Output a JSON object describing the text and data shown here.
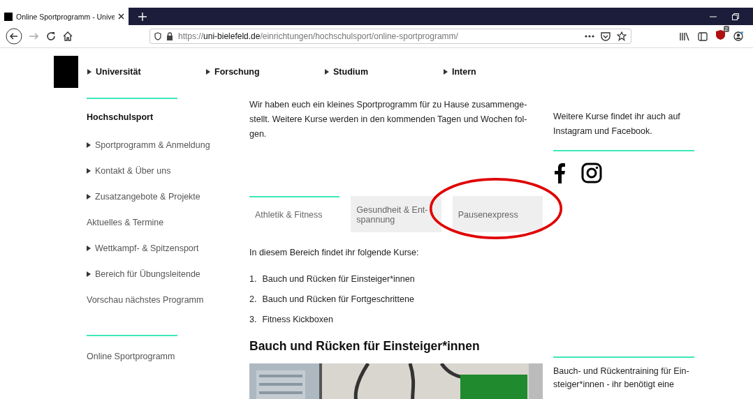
{
  "browser": {
    "tab_title": "Online Sportprogramm - Unive",
    "url_scheme": "https://",
    "url_host": "uni-bielefeld.de",
    "url_path": "/einrichtungen/hochschulsport/online-sportprogramm/",
    "extension_badge": "2"
  },
  "nav": [
    {
      "label": "Universität"
    },
    {
      "label": "Forschung"
    },
    {
      "label": "Studium"
    },
    {
      "label": "Intern"
    }
  ],
  "sidebar": {
    "title": "Hochschulsport",
    "items": [
      {
        "label": "Sportprogramm & Anmeldung",
        "kind": "submenu"
      },
      {
        "label": "Kontakt & Über uns",
        "kind": "submenu"
      },
      {
        "label": "Zusatzangebote & Projekte",
        "kind": "submenu"
      },
      {
        "label": "Aktuelles & Termine",
        "kind": "link"
      },
      {
        "label": "Wettkampf- & Spitzensport",
        "kind": "submenu"
      },
      {
        "label": "Bereich für Übungsleitende",
        "kind": "submenu"
      },
      {
        "label": "Vorschau nächstes Programm",
        "kind": "link"
      }
    ],
    "footer_item": "Online Sportprogramm"
  },
  "intro_lines": [
    "Wir haben euch ein kleines Sportprogramm für zu Hause zusammenge-",
    "stellt. Weitere Kurse werden in den kommenden Tagen und Wochen fol-",
    "gen."
  ],
  "tabs": [
    {
      "lines": [
        "Athletik & Fitness"
      ],
      "selected": true
    },
    {
      "lines": [
        "Gesundheit & Ent-",
        "spannung"
      ],
      "selected": false
    },
    {
      "lines": [
        "Pausenexpress"
      ],
      "selected": false
    }
  ],
  "list_intro": "In diesem Bereich findet ihr folgende Kurse:",
  "courses": [
    {
      "number": "1.",
      "title": "Bauch und Rücken für Einsteiger*innen"
    },
    {
      "number": "2.",
      "title": "Bauch und Rücken für Fortgeschrittene"
    },
    {
      "number": "3.",
      "title": "Fitness Kickboxen"
    }
  ],
  "section_heading": "Bauch und Rücken für Einsteiger*innen",
  "video": {
    "kind": "picture"
  },
  "aside": {
    "social_lines": [
      "Weitere Kurse findet ihr auch auf",
      "Instagram und Facebook."
    ],
    "course_lines": [
      "Bauch- und Rückentraining für Ein-",
      "steiger*innen - ihr benötigt eine"
    ]
  }
}
